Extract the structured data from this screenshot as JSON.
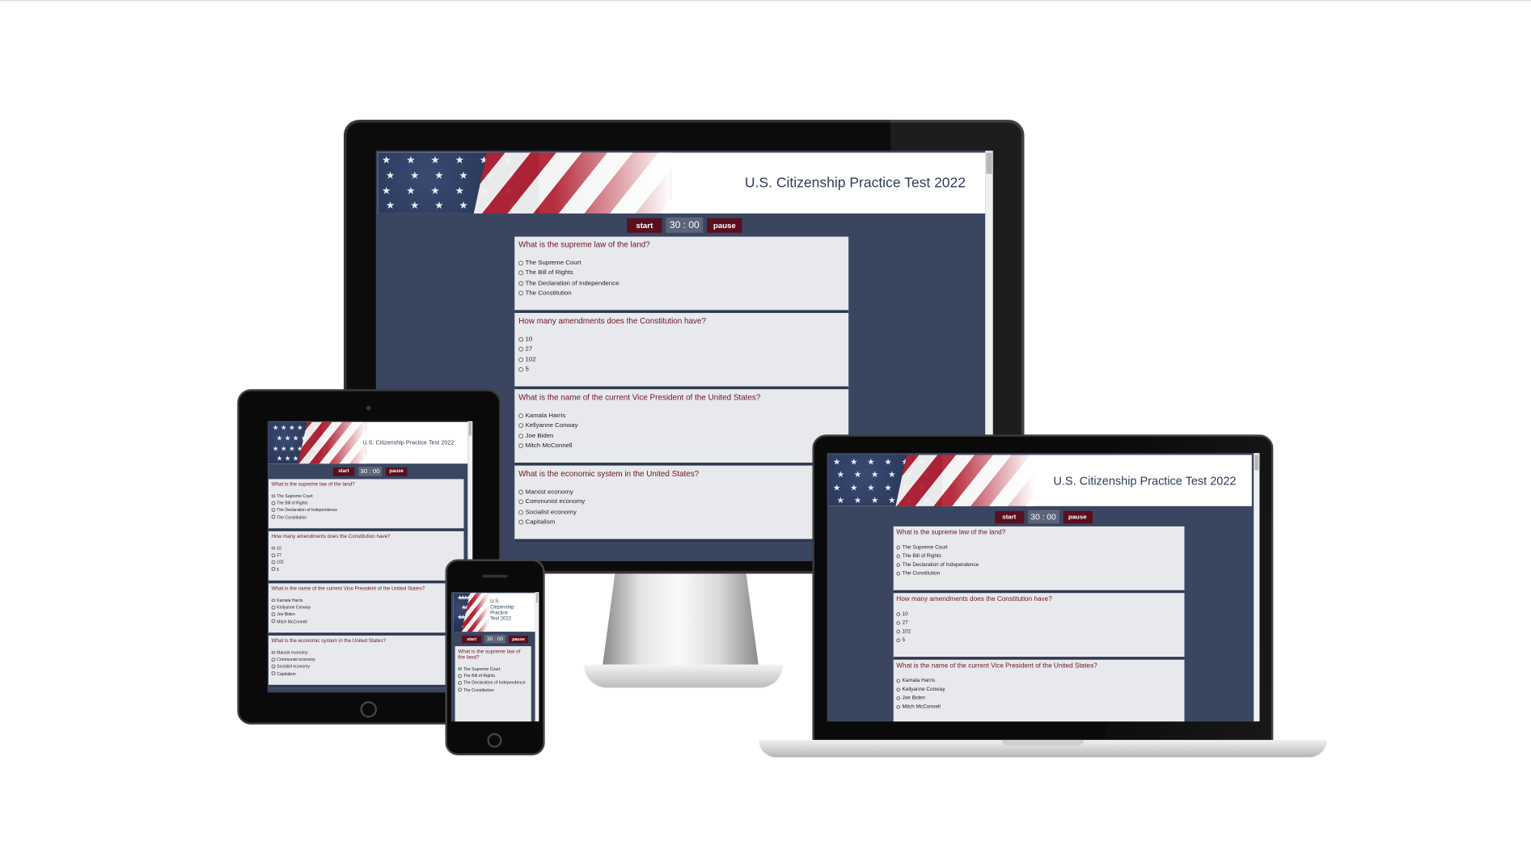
{
  "site": {
    "title": "U.S. Citizenship Practice Test 2022",
    "start_label": "start",
    "pause_label": "pause",
    "timer": "30 : 00"
  },
  "questions": [
    {
      "text": "What is the supreme law of the land?",
      "options": [
        "The Supreme Court",
        "The Bill of Rights",
        "The Declaration of Independence",
        "The Constitution"
      ]
    },
    {
      "text": "How many amendments does the Constitution have?",
      "options": [
        "10",
        "27",
        "102",
        "5"
      ]
    },
    {
      "text": "What is the name of the current Vice President of the United States?",
      "options": [
        "Kamala Harris",
        "Kellyanne Conway",
        "Joe Biden",
        "Mitch McConnell"
      ]
    },
    {
      "text": "What is the economic system in the United States?",
      "options": [
        "Marxist economy",
        "Communist economy",
        "Socialist economy",
        "Capitalism"
      ]
    }
  ],
  "phone_title_lines": [
    "U.S.",
    "Citizenship",
    "Practice",
    "Test 2022"
  ],
  "colors": {
    "page_bg": "#3a4660",
    "button": "#5a0f1e",
    "question_bg": "#e8e9ed",
    "question_text": "#6b1524",
    "title": "#2d3b55"
  }
}
